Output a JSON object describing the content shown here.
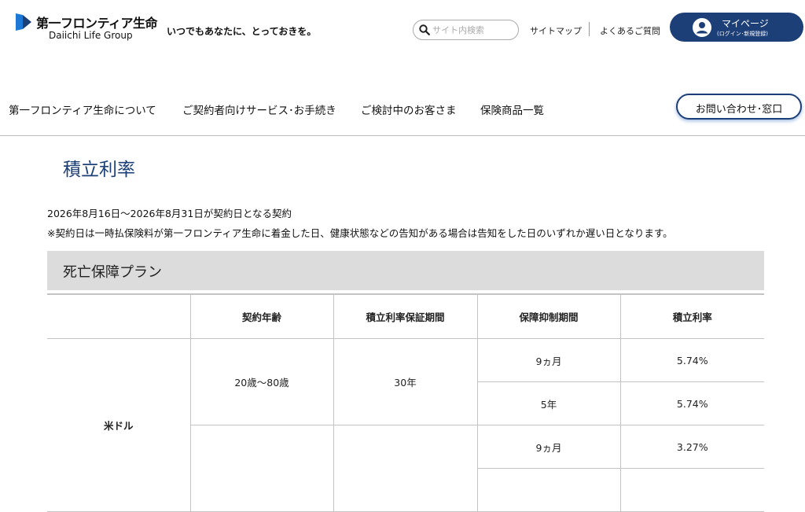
{
  "header": {
    "logo_ja": "第一フロンティア生命",
    "logo_en": "Daiichi Life Group",
    "tagline": "いつでもあなたに、とっておきを。",
    "search_placeholder": "サイト内検索",
    "sitemap": "サイトマップ",
    "faq": "よくあるご質問",
    "mypage_label": "マイページ",
    "mypage_sub": "(ログイン･新規登録)"
  },
  "nav": {
    "items": [
      "第一フロンティア生命について",
      "ご契約者向けサービス･お手続き",
      "ご検討中のお客さま",
      "保険商品一覧"
    ],
    "contact": "お問い合わせ･窓口"
  },
  "main": {
    "title": "積立利率",
    "period": "2026年8月16日～2026年8月31日が契約日となる契約",
    "note": "※契約日は一時払保険料が第一フロンティア生命に着金した日、健康状態などの告知がある場合は告知をした日のいずれか遅い日となります。",
    "section": "死亡保障プラン",
    "table": {
      "headers": [
        "",
        "契約年齢",
        "積立利率保証期間",
        "保障抑制期間",
        "積立利率"
      ],
      "currency": "米ドル",
      "age": "20歳～80歳",
      "guarantee": "30年",
      "rows": [
        {
          "period": "9ヵ月",
          "rate": "5.74%"
        },
        {
          "period": "5年",
          "rate": "5.74%"
        },
        {
          "period": "9ヵ月",
          "rate": "3.27%"
        }
      ]
    }
  },
  "colors": {
    "brand": "#1c3f78",
    "logo_light": "#1e78d6",
    "logo_dark": "#1c3f78",
    "section_bg": "#dcdcdc"
  }
}
